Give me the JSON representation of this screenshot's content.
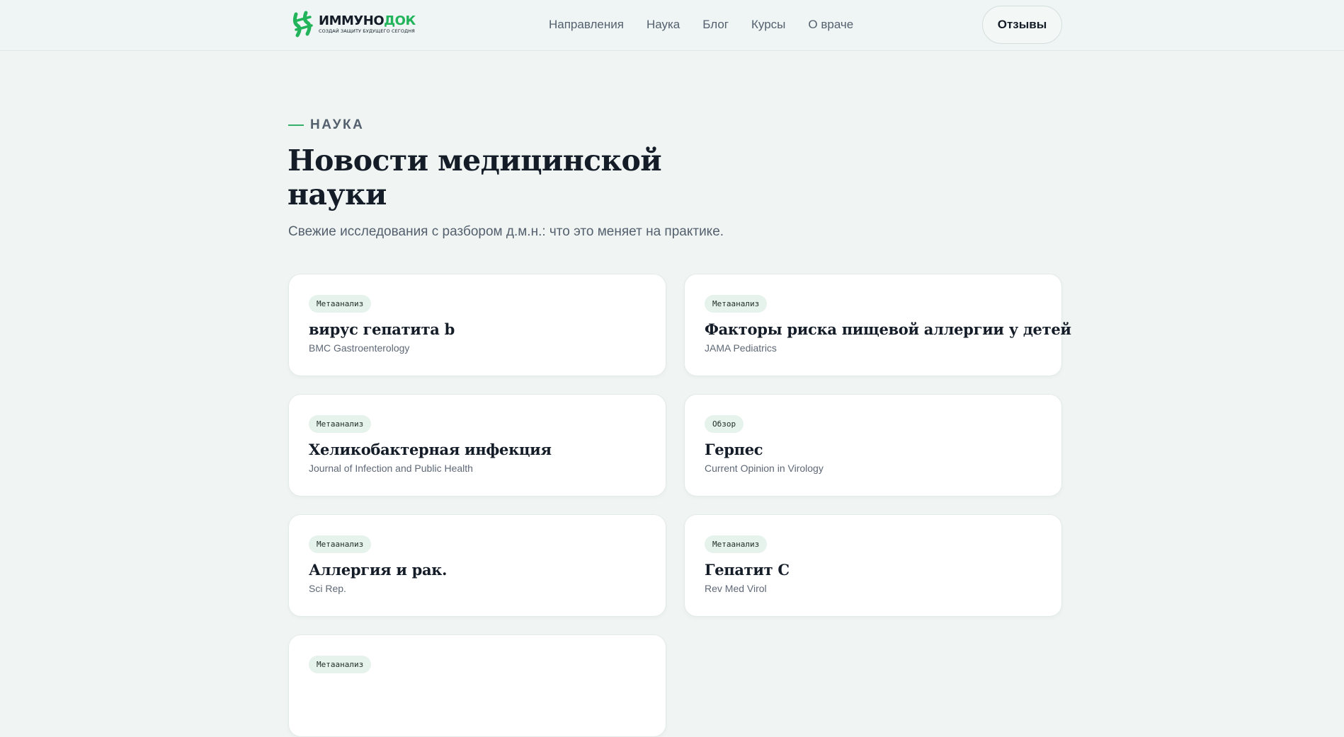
{
  "header": {
    "logo": {
      "name_part1": "ИММУНО",
      "name_part2": "ДОК",
      "tagline": "СОЗДАЙ ЗАЩИТУ БУДУЩЕГО СЕГОДНЯ"
    },
    "nav": [
      "Направления",
      "Наука",
      "Блог",
      "Курсы",
      "О враче"
    ],
    "reviews_label": "Отзывы"
  },
  "section": {
    "eyebrow": "НАУКА",
    "title": "Новости медицинской науки",
    "subtitle": "Свежие исследования с разбором д.м.н.: что это меняет на практике."
  },
  "articles": [
    {
      "badge": "Метаанализ",
      "title": "вирус гепатита b",
      "source": "BMC Gastroenterology"
    },
    {
      "badge": "Метаанализ",
      "title": "Факторы риска пищевой аллергии у детей",
      "source": "JAMA Pediatrics"
    },
    {
      "badge": "Метаанализ",
      "title": "Хеликобактерная инфекция",
      "source": "Journal of Infection and Public Health"
    },
    {
      "badge": "Обзор",
      "title": "Герпес",
      "source": "Current Opinion in Virology"
    },
    {
      "badge": "Метаанализ",
      "title": "Аллергия и рак.",
      "source": "Sci Rep."
    },
    {
      "badge": "Метаанализ",
      "title": "Гепатит C",
      "source": "Rev Med Virol"
    },
    {
      "badge": "Метаанализ",
      "title": "",
      "source": ""
    }
  ],
  "colors": {
    "accent": "#22b45a",
    "background": "#f0f5f3",
    "text": "#141c28"
  }
}
